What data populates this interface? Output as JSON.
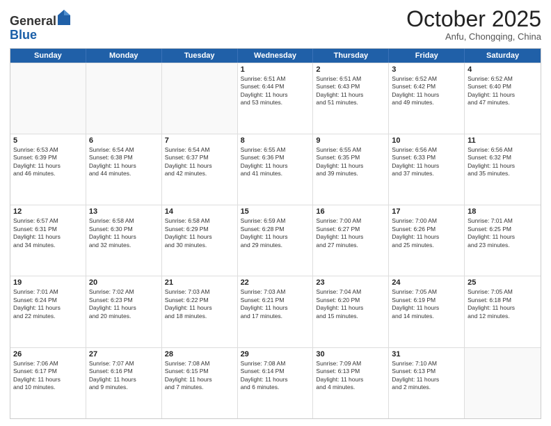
{
  "header": {
    "logo_general": "General",
    "logo_blue": "Blue",
    "month": "October 2025",
    "location": "Anfu, Chongqing, China"
  },
  "weekdays": [
    "Sunday",
    "Monday",
    "Tuesday",
    "Wednesday",
    "Thursday",
    "Friday",
    "Saturday"
  ],
  "rows": [
    [
      {
        "day": "",
        "text": ""
      },
      {
        "day": "",
        "text": ""
      },
      {
        "day": "",
        "text": ""
      },
      {
        "day": "1",
        "text": "Sunrise: 6:51 AM\nSunset: 6:44 PM\nDaylight: 11 hours\nand 53 minutes."
      },
      {
        "day": "2",
        "text": "Sunrise: 6:51 AM\nSunset: 6:43 PM\nDaylight: 11 hours\nand 51 minutes."
      },
      {
        "day": "3",
        "text": "Sunrise: 6:52 AM\nSunset: 6:42 PM\nDaylight: 11 hours\nand 49 minutes."
      },
      {
        "day": "4",
        "text": "Sunrise: 6:52 AM\nSunset: 6:40 PM\nDaylight: 11 hours\nand 47 minutes."
      }
    ],
    [
      {
        "day": "5",
        "text": "Sunrise: 6:53 AM\nSunset: 6:39 PM\nDaylight: 11 hours\nand 46 minutes."
      },
      {
        "day": "6",
        "text": "Sunrise: 6:54 AM\nSunset: 6:38 PM\nDaylight: 11 hours\nand 44 minutes."
      },
      {
        "day": "7",
        "text": "Sunrise: 6:54 AM\nSunset: 6:37 PM\nDaylight: 11 hours\nand 42 minutes."
      },
      {
        "day": "8",
        "text": "Sunrise: 6:55 AM\nSunset: 6:36 PM\nDaylight: 11 hours\nand 41 minutes."
      },
      {
        "day": "9",
        "text": "Sunrise: 6:55 AM\nSunset: 6:35 PM\nDaylight: 11 hours\nand 39 minutes."
      },
      {
        "day": "10",
        "text": "Sunrise: 6:56 AM\nSunset: 6:33 PM\nDaylight: 11 hours\nand 37 minutes."
      },
      {
        "day": "11",
        "text": "Sunrise: 6:56 AM\nSunset: 6:32 PM\nDaylight: 11 hours\nand 35 minutes."
      }
    ],
    [
      {
        "day": "12",
        "text": "Sunrise: 6:57 AM\nSunset: 6:31 PM\nDaylight: 11 hours\nand 34 minutes."
      },
      {
        "day": "13",
        "text": "Sunrise: 6:58 AM\nSunset: 6:30 PM\nDaylight: 11 hours\nand 32 minutes."
      },
      {
        "day": "14",
        "text": "Sunrise: 6:58 AM\nSunset: 6:29 PM\nDaylight: 11 hours\nand 30 minutes."
      },
      {
        "day": "15",
        "text": "Sunrise: 6:59 AM\nSunset: 6:28 PM\nDaylight: 11 hours\nand 29 minutes."
      },
      {
        "day": "16",
        "text": "Sunrise: 7:00 AM\nSunset: 6:27 PM\nDaylight: 11 hours\nand 27 minutes."
      },
      {
        "day": "17",
        "text": "Sunrise: 7:00 AM\nSunset: 6:26 PM\nDaylight: 11 hours\nand 25 minutes."
      },
      {
        "day": "18",
        "text": "Sunrise: 7:01 AM\nSunset: 6:25 PM\nDaylight: 11 hours\nand 23 minutes."
      }
    ],
    [
      {
        "day": "19",
        "text": "Sunrise: 7:01 AM\nSunset: 6:24 PM\nDaylight: 11 hours\nand 22 minutes."
      },
      {
        "day": "20",
        "text": "Sunrise: 7:02 AM\nSunset: 6:23 PM\nDaylight: 11 hours\nand 20 minutes."
      },
      {
        "day": "21",
        "text": "Sunrise: 7:03 AM\nSunset: 6:22 PM\nDaylight: 11 hours\nand 18 minutes."
      },
      {
        "day": "22",
        "text": "Sunrise: 7:03 AM\nSunset: 6:21 PM\nDaylight: 11 hours\nand 17 minutes."
      },
      {
        "day": "23",
        "text": "Sunrise: 7:04 AM\nSunset: 6:20 PM\nDaylight: 11 hours\nand 15 minutes."
      },
      {
        "day": "24",
        "text": "Sunrise: 7:05 AM\nSunset: 6:19 PM\nDaylight: 11 hours\nand 14 minutes."
      },
      {
        "day": "25",
        "text": "Sunrise: 7:05 AM\nSunset: 6:18 PM\nDaylight: 11 hours\nand 12 minutes."
      }
    ],
    [
      {
        "day": "26",
        "text": "Sunrise: 7:06 AM\nSunset: 6:17 PM\nDaylight: 11 hours\nand 10 minutes."
      },
      {
        "day": "27",
        "text": "Sunrise: 7:07 AM\nSunset: 6:16 PM\nDaylight: 11 hours\nand 9 minutes."
      },
      {
        "day": "28",
        "text": "Sunrise: 7:08 AM\nSunset: 6:15 PM\nDaylight: 11 hours\nand 7 minutes."
      },
      {
        "day": "29",
        "text": "Sunrise: 7:08 AM\nSunset: 6:14 PM\nDaylight: 11 hours\nand 6 minutes."
      },
      {
        "day": "30",
        "text": "Sunrise: 7:09 AM\nSunset: 6:13 PM\nDaylight: 11 hours\nand 4 minutes."
      },
      {
        "day": "31",
        "text": "Sunrise: 7:10 AM\nSunset: 6:13 PM\nDaylight: 11 hours\nand 2 minutes."
      },
      {
        "day": "",
        "text": ""
      }
    ]
  ]
}
